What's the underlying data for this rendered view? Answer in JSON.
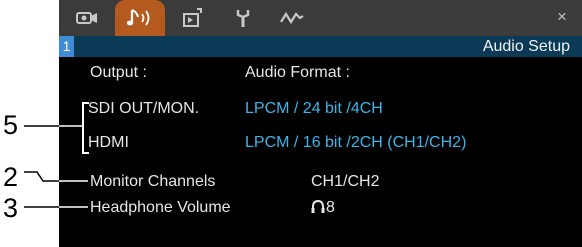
{
  "window": {
    "title": "Audio Setup",
    "page_number": "1"
  },
  "tabs": [
    {
      "icon": "camera-settings-icon",
      "active": false
    },
    {
      "icon": "audio-note-icon",
      "active": true
    },
    {
      "icon": "playback-settings-icon",
      "active": false
    },
    {
      "icon": "wrench-icon",
      "active": false
    },
    {
      "icon": "waveform-icon",
      "active": false
    }
  ],
  "close_label": "×",
  "header": {
    "left": "Output :",
    "right": "Audio Format :"
  },
  "rows": [
    {
      "label": "SDI OUT/MON.",
      "value": "LPCM / 24 bit /4CH"
    },
    {
      "label": "HDMI",
      "value": "LPCM / 16 bit /2CH (CH1/CH2)"
    },
    {
      "label": "Monitor Channels",
      "value": "CH1/CH2"
    },
    {
      "label": "Headphone Volume",
      "value": "8"
    }
  ],
  "callouts": [
    "5",
    "2",
    "3"
  ],
  "colors": {
    "accent_tab": "#b45a1f",
    "value_cyan": "#39b6ea",
    "page_bar": "#0b3a56"
  }
}
